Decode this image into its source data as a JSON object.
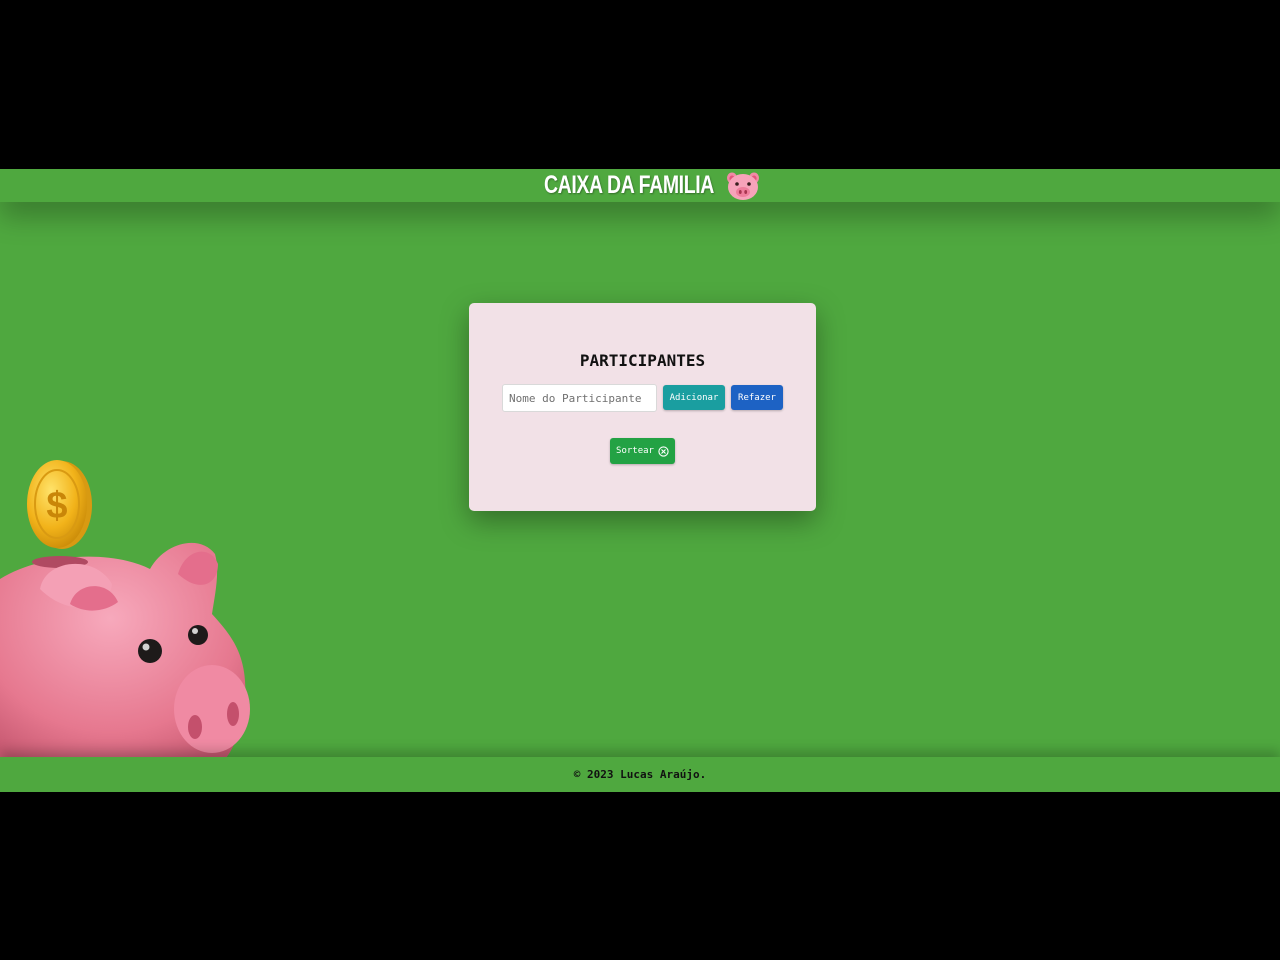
{
  "header": {
    "title": "CAIXA DA FAMILIA",
    "emoji_icon": "pig-face-icon"
  },
  "participants_card": {
    "title": "PARTICIPANTES",
    "name_input": {
      "value": "",
      "placeholder": "Nome do Participante"
    },
    "add_button_label": "Adicionar",
    "redo_button_label": "Refazer",
    "draw_button_label": "Sortear",
    "draw_button_icon": "circle-x-icon"
  },
  "illustration": {
    "name": "piggy-bank-with-coin"
  },
  "footer": {
    "text": "© 2023 Lucas Araújo."
  },
  "colors": {
    "page_background": "#4fa83f",
    "card_background": "#f2e1e7",
    "add_button": "#1a9ea0",
    "redo_button": "#1d62c4",
    "draw_button": "#23a244",
    "letterbox": "#000000"
  }
}
